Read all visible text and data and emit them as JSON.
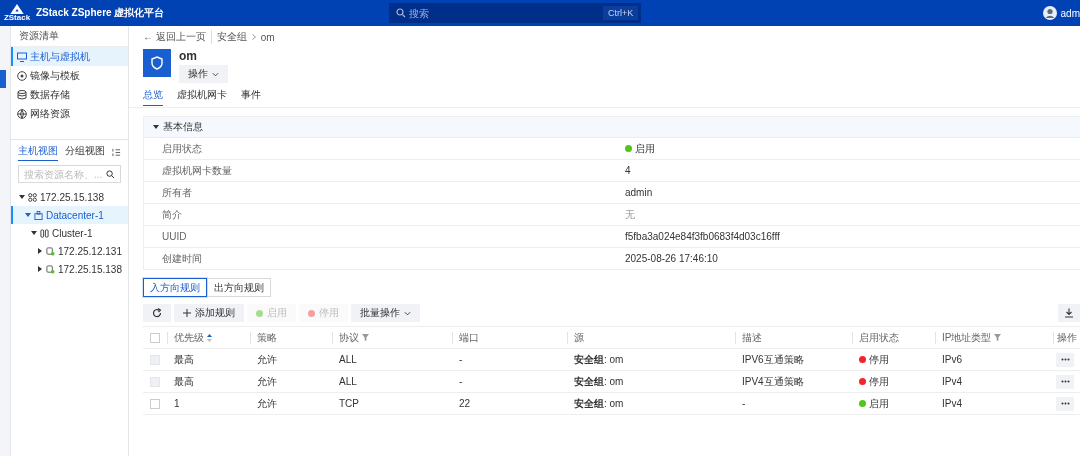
{
  "header": {
    "brand_mark": "ZStack",
    "title": "ZStack ZSphere 虚拟化平台",
    "search": {
      "placeholder": "搜索",
      "shortcut": "Ctrl+K"
    },
    "user": "adm"
  },
  "sidebar": {
    "heading": "资源清单",
    "menu": [
      {
        "label": "主机与虚拟机",
        "selected": true
      },
      {
        "label": "镜像与模板",
        "selected": false
      },
      {
        "label": "数据存储",
        "selected": false
      },
      {
        "label": "网络资源",
        "selected": false
      }
    ],
    "view_tabs": [
      {
        "label": "主机视图",
        "selected": true
      },
      {
        "label": "分组视图",
        "selected": false
      }
    ],
    "tree_search": {
      "placeholder": "搜索资源名称、..."
    },
    "tree": [
      {
        "label": "172.25.15.138",
        "kind": "zone",
        "expanded": true,
        "selected": false,
        "children": [
          {
            "label": "Datacenter-1",
            "kind": "datacenter",
            "expanded": true,
            "selected": true,
            "children": [
              {
                "label": "Cluster-1",
                "kind": "cluster",
                "expanded": true,
                "selected": false,
                "children": [
                  {
                    "label": "172.25.12.131",
                    "kind": "host",
                    "expanded": false,
                    "selected": false
                  },
                  {
                    "label": "172.25.15.138",
                    "kind": "host",
                    "expanded": false,
                    "selected": false
                  }
                ]
              }
            ]
          }
        ]
      }
    ]
  },
  "breadcrumb": {
    "back": "← 返回上一页",
    "items": [
      "安全组",
      "om"
    ]
  },
  "resource": {
    "name": "om",
    "action_button": "操作"
  },
  "tabs": [
    {
      "label": "总览",
      "selected": true
    },
    {
      "label": "虚拟机网卡",
      "selected": false
    },
    {
      "label": "事件",
      "selected": false
    }
  ],
  "basic_info": {
    "title": "基本信息",
    "expanded": true,
    "fields": [
      {
        "label": "启用状态",
        "value": "启用",
        "kind": "status",
        "enabled": true
      },
      {
        "label": "虚拟机网卡数量",
        "value": "4",
        "kind": "text"
      },
      {
        "label": "所有者",
        "value": "admin",
        "kind": "text"
      },
      {
        "label": "简介",
        "value": "无",
        "kind": "empty"
      },
      {
        "label": "UUID",
        "value": "f5fba3a024e84f3fb0683f4d03c16fff",
        "kind": "text"
      },
      {
        "label": "创建时间",
        "value": "2025-08-26 17:46:10",
        "kind": "text"
      }
    ]
  },
  "rule_tabs": [
    {
      "label": "入方向规则",
      "selected": true
    },
    {
      "label": "出方向规则",
      "selected": false
    }
  ],
  "toolbar": [
    {
      "label": "添加规则",
      "kind": "add",
      "disabled": false
    },
    {
      "label": "启用",
      "kind": "enable",
      "disabled": true
    },
    {
      "label": "停用",
      "kind": "disable",
      "disabled": true
    },
    {
      "label": "批量操作",
      "kind": "menu",
      "disabled": false
    }
  ],
  "table": {
    "select_all": {
      "checked": false
    },
    "columns": [
      {
        "label": "优先级",
        "kind": "sort"
      },
      {
        "label": "策略",
        "kind": "plain"
      },
      {
        "label": "协议",
        "kind": "filter"
      },
      {
        "label": "端口",
        "kind": "plain"
      },
      {
        "label": "源",
        "kind": "plain"
      },
      {
        "label": "描述",
        "kind": "plain"
      },
      {
        "label": "启用状态",
        "kind": "plain"
      },
      {
        "label": "IP地址类型",
        "kind": "filter"
      },
      {
        "label": "操作",
        "kind": "plain"
      }
    ],
    "rows": [
      {
        "checked": false,
        "disabled": true,
        "priority": "最高",
        "policy": "允许",
        "protocol": "ALL",
        "port": "-",
        "source": "**安全组**: om",
        "description": "IPV6互通策略",
        "status": "停用",
        "enabled": false,
        "ip_type": "IPv6"
      },
      {
        "checked": false,
        "disabled": true,
        "priority": "最高",
        "policy": "允许",
        "protocol": "ALL",
        "port": "-",
        "source": "**安全组**: om",
        "description": "IPV4互通策略",
        "status": "停用",
        "enabled": false,
        "ip_type": "IPv4"
      },
      {
        "checked": false,
        "disabled": false,
        "priority": "1",
        "policy": "允许",
        "protocol": "TCP",
        "port": "22",
        "source": "**安全组**: om",
        "description": "-",
        "status": "启用",
        "enabled": true,
        "ip_type": "IPv4"
      }
    ]
  }
}
